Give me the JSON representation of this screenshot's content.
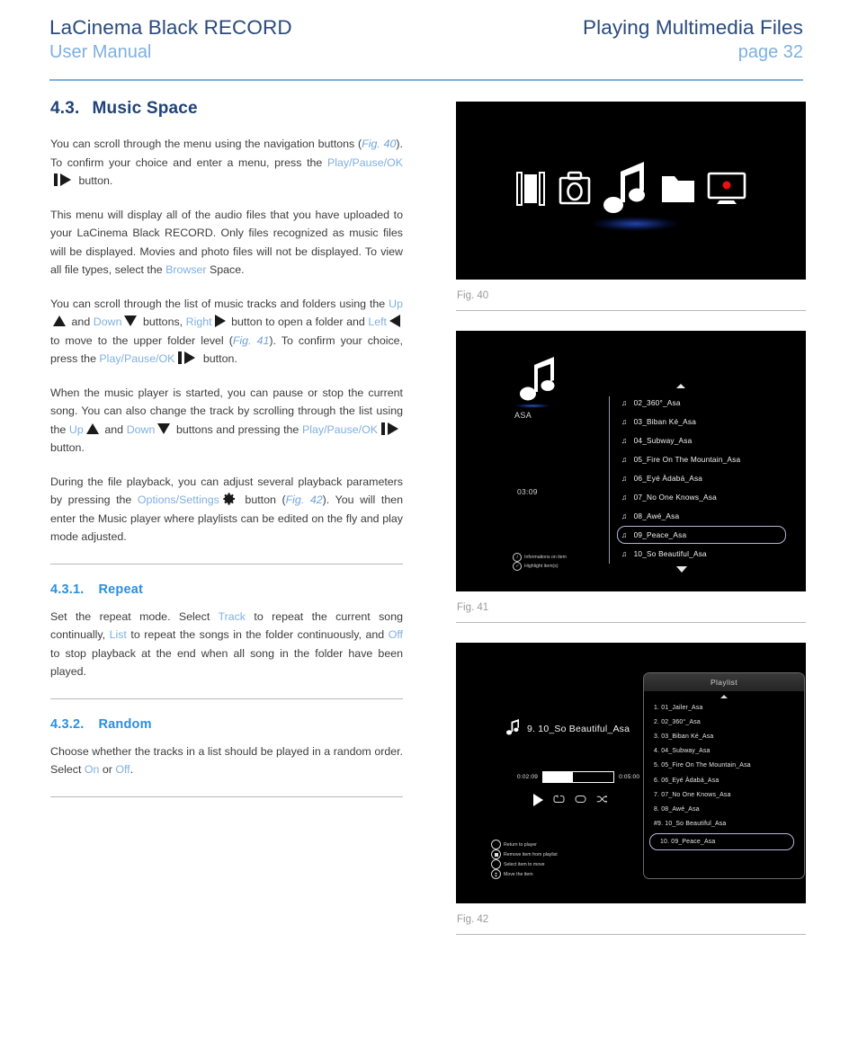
{
  "header": {
    "product_title": "LaCinema Black RECORD",
    "doc_type": "User Manual",
    "chapter": "Playing Multimedia Files",
    "page_label": "page 32"
  },
  "section": {
    "number": "4.3.",
    "title": "Music Space",
    "paragraphs": {
      "p1_a": "You can scroll through the menu using the navigation buttons (",
      "p1_fig": "Fig. 40",
      "p1_b": "). To confirm your choice and enter a menu, press the ",
      "p1_link": "Play/Pause/OK",
      "p1_c": " button.",
      "p2": "This menu will display all of the audio files that you have uploaded to your LaCinema Black RECORD.  Only files recognized as music files will be displayed. Movies and photo files will not be displayed. To view all file types, select the ",
      "p2_link": "Browser",
      "p2_end": " Space.",
      "p3_a": "You can scroll through the list of music tracks and folders using the ",
      "p3_up": "Up",
      "p3_and": " and ",
      "p3_down": "Down",
      "p3_b": " buttons, ",
      "p3_right": "Right",
      "p3_c": " button to open a folder and ",
      "p3_left": "Left",
      "p3_d": " to move to the upper folder level (",
      "p3_fig": "Fig. 41",
      "p3_e": ").  To confirm your choice, press the ",
      "p3_ok": "Play/Pause/OK",
      "p3_f": " button.",
      "p4_a": "When the music player is started, you can pause or stop the current song.  You can also change the track by scrolling through the list using the ",
      "p4_up": "Up",
      "p4_and": " and ",
      "p4_down": "Down",
      "p4_b": " buttons and pressing the ",
      "p4_ok": "Play/Pause/OK",
      "p4_c": " button.",
      "p5_a": "During the file playback, you can adjust several playback parameters by pressing the ",
      "p5_link": "Options/Settings",
      "p5_b": " button (",
      "p5_fig": "Fig. 42",
      "p5_c": "). You will then enter the Music player where playlists can be edited on the fly and play mode adjusted."
    }
  },
  "subsection_repeat": {
    "number": "4.3.1.",
    "title": "Repeat",
    "text_a": "Set the repeat mode. Select ",
    "opt_track": "Track",
    "text_b": " to repeat the current song continually, ",
    "opt_list": "List",
    "text_c": " to repeat the songs in the folder continuously, and ",
    "opt_off": "Off",
    "text_d": " to stop playback at the end when all song in the folder have been played."
  },
  "subsection_random": {
    "number": "4.3.2.",
    "title": "Random",
    "text_a": "Choose whether the tracks in a list should be played in a random order.  Select ",
    "opt_on": "On",
    "text_b": " or ",
    "opt_off": "Off",
    "text_c": "."
  },
  "figures": {
    "fig40": {
      "caption": "Fig. 40",
      "icons": [
        "film-strip-icon",
        "camera-icon",
        "music-note-icon",
        "folder-icon",
        "recorder-tv-icon"
      ],
      "selected_icon": "music-note-icon",
      "record_dot_color": "#e81010"
    },
    "fig41": {
      "caption": "Fig. 41",
      "artist": "ASA",
      "duration": "03:09",
      "legend": [
        {
          "key": "i",
          "label": "Informations on item"
        },
        {
          "key": "✓",
          "label": "Highlight item(s)"
        }
      ],
      "tracks": [
        "02_360°_Asa",
        "03_Bibanké_Asa",
        "04_Subway_Asa",
        "05_Fire On The Mountain_Asa",
        "06_Eyé Àdabá_Asa",
        "07_No One Knows_Asa",
        "08_Awé_Asa",
        "09_Peace_Asa",
        "10_So Beautiful_Asa"
      ],
      "tracks_display": [
        "02_360°_Asa",
        "03_Biban Ké_Asa",
        "04_Subway_Asa",
        "05_Fire On The Mountain_Asa",
        "06_Eyé Àdabá_Asa",
        "07_No One Knows_Asa",
        "08_Awé_Asa",
        "09_Peace_Asa",
        "10_So Beautiful_Asa"
      ],
      "selected_track": "09_Peace_Asa"
    },
    "fig42": {
      "caption": "Fig. 42",
      "now_playing": "9. 10_So Beautiful_Asa",
      "elapsed": "0:02:09",
      "total": "0:05:00",
      "progress_percent": 42,
      "panel_title": "Playlist",
      "playlist": [
        "1. 01_Jailer_Asa",
        "2. 02_360°_Asa",
        "3. 03_Biban Ké_Asa",
        "4. 04_Subway_Asa",
        "5. 05_Fire On The Mountain_Asa",
        "6. 06_Eyé Àdabá_Asa",
        "7. 07_No One Knows_Asa",
        "8. 08_Awé_Asa"
      ],
      "current_item": "#9. 10_So Beautiful_Asa",
      "selected_item": "10. 09_Peace_Asa",
      "legend": [
        "Return to player",
        "Remove item from playlist",
        "Select item to move",
        "Move the item"
      ],
      "controls": [
        "play-icon",
        "repeat-track-icon",
        "repeat-all-icon",
        "shuffle-icon"
      ]
    }
  }
}
